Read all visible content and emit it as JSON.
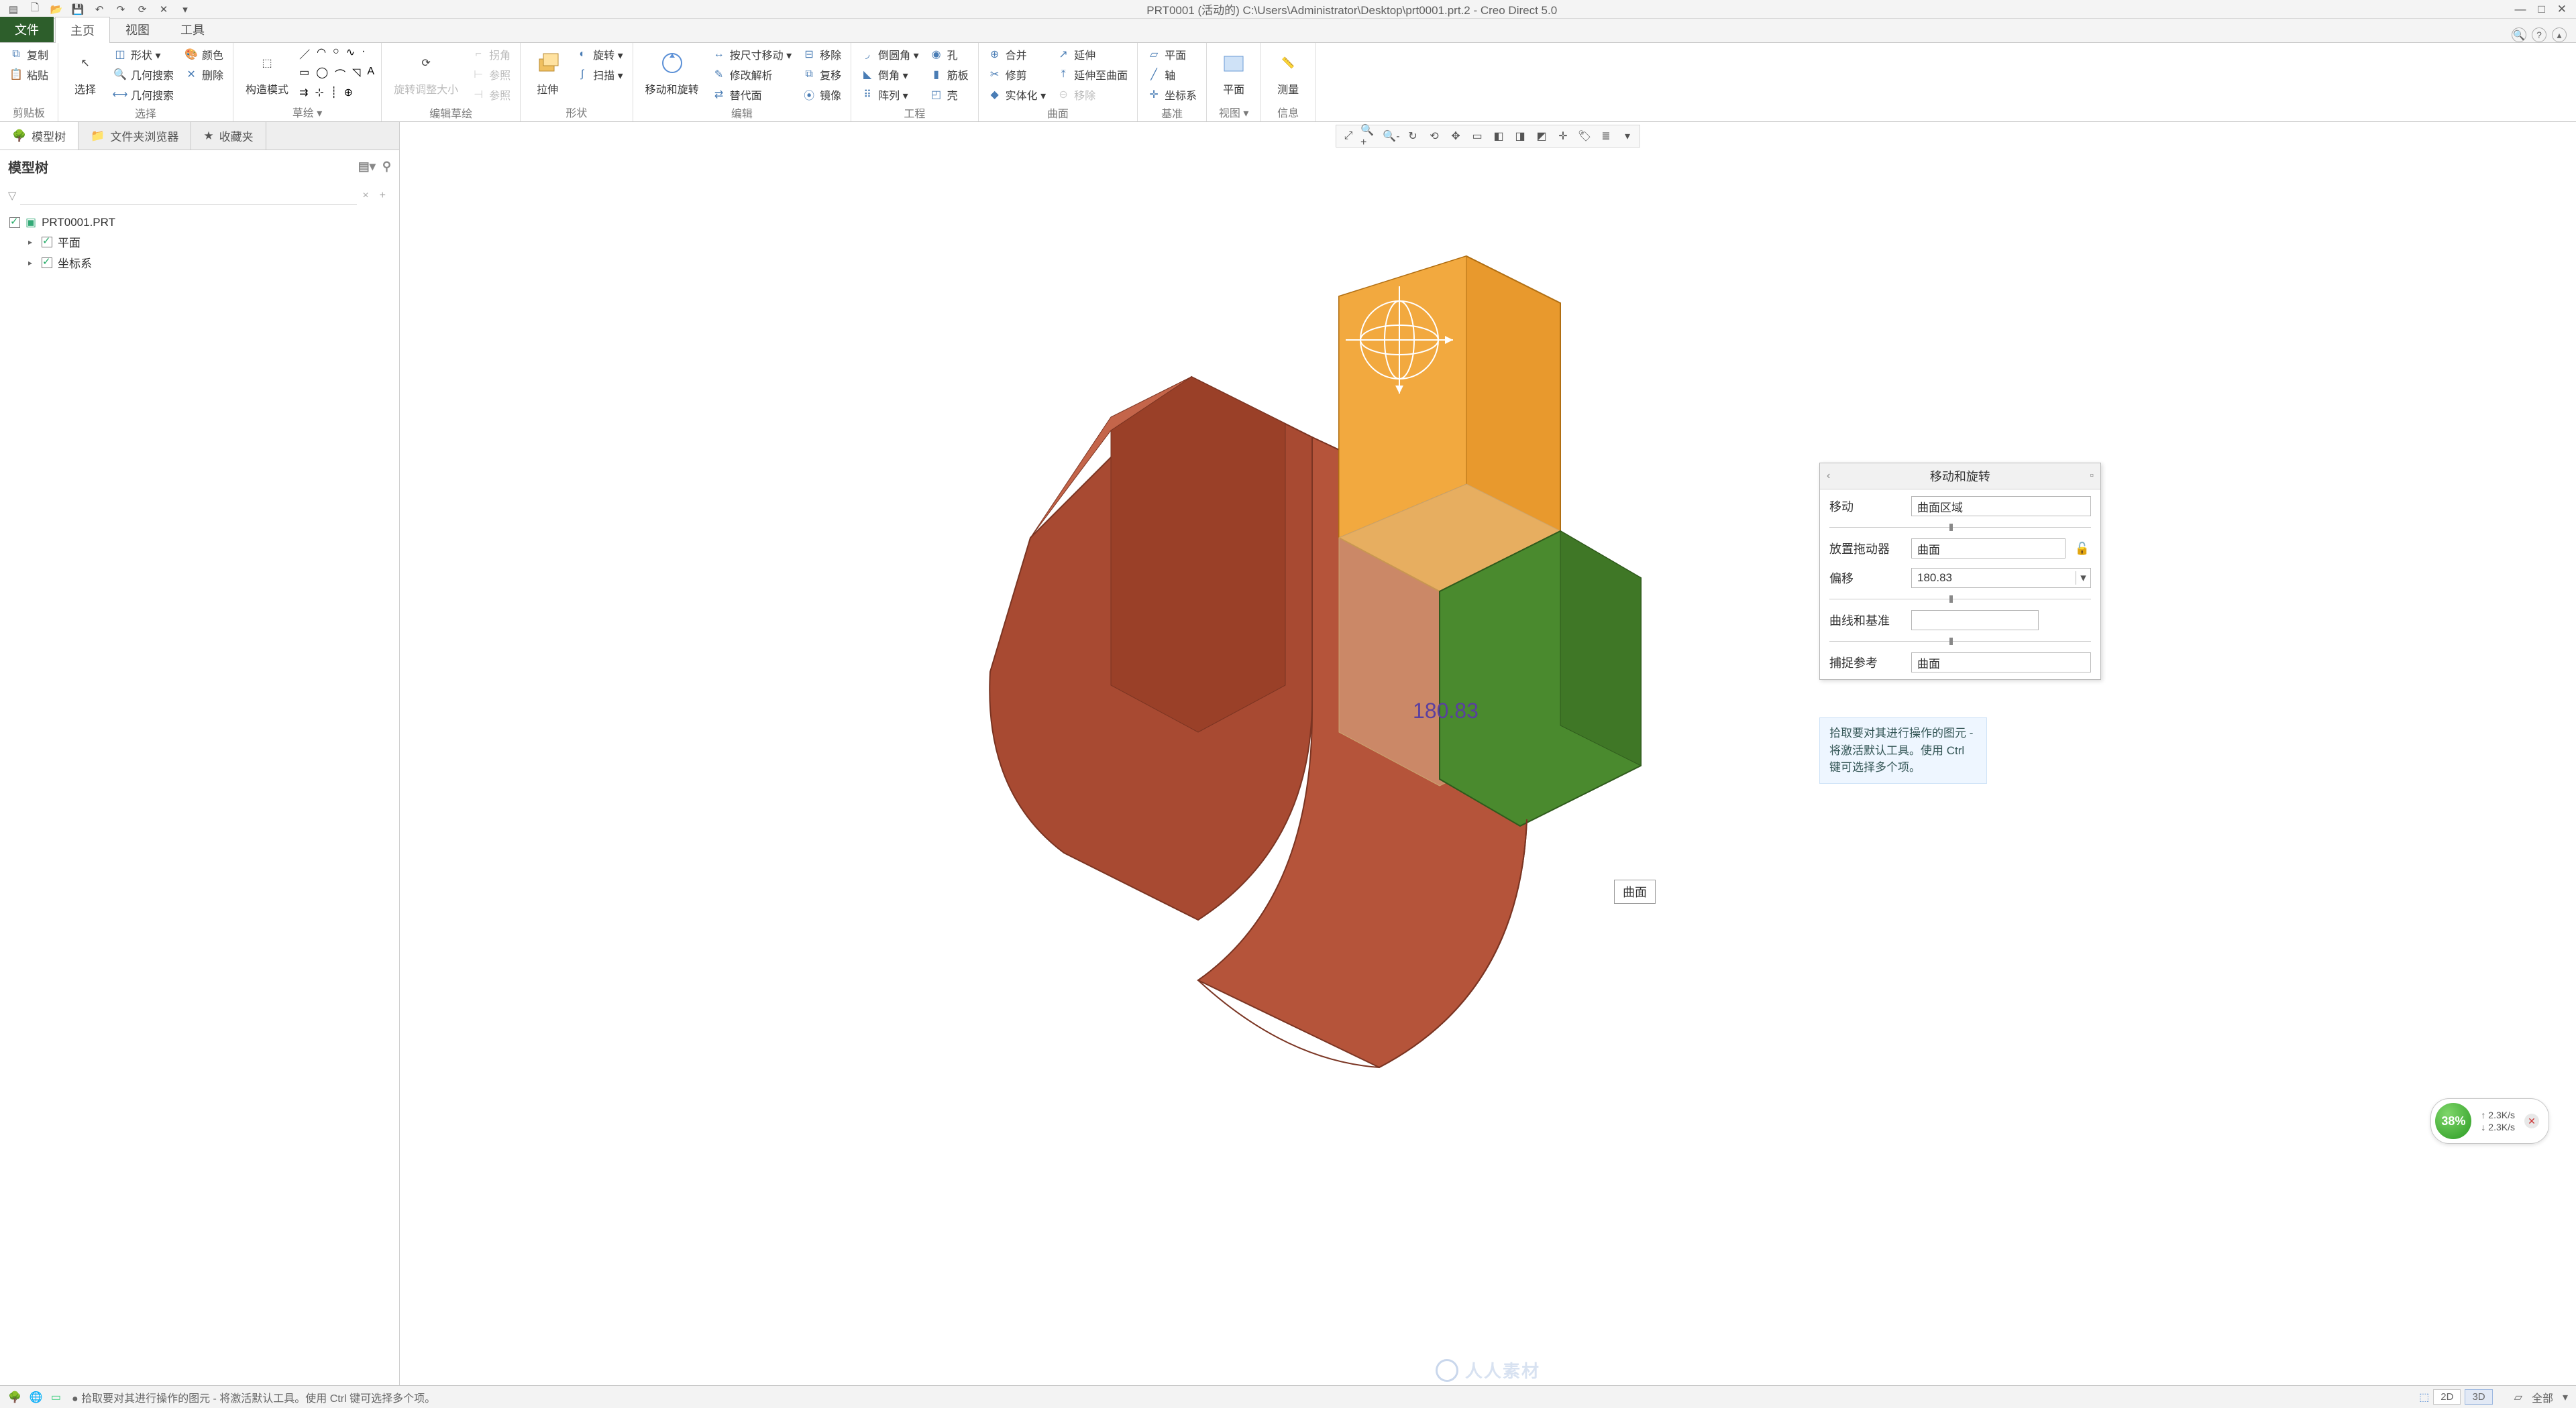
{
  "title": "PRT0001 (活动的) C:\\Users\\Administrator\\Desktop\\prt0001.prt.2 - Creo Direct 5.0",
  "tabs": {
    "file": "文件",
    "home": "主页",
    "view": "视图",
    "tools": "工具"
  },
  "ribbon": {
    "g1": {
      "label": "剪贴板",
      "copy": "复制",
      "paste": "粘贴"
    },
    "g2": {
      "label": "选择",
      "select": "选择",
      "shape": "形状 ▾",
      "geosearch": "几何搜索",
      "color": "颜色",
      "delete": "删除",
      "dimsearch": "几何搜索"
    },
    "g3": {
      "label": "草绘 ▾",
      "mode": "构造模式"
    },
    "g4": {
      "label": "编辑草绘",
      "rot": "旋转调整大小",
      "trim": "拐角",
      "ref1": "参照",
      "ref2": "参照"
    },
    "g5": {
      "label": "形状",
      "extrude": "拉伸",
      "revolve": "旋转 ▾",
      "sweep": "扫描 ▾"
    },
    "g6": {
      "label": "编辑",
      "moverot": "移动和旋转",
      "dimsmove": "按尺寸移动 ▾",
      "analyze": "修改解析",
      "replace": "替代面",
      "move": "移除",
      "copyop": "复移",
      "mirror": "镜像"
    },
    "g7": {
      "label": "工程",
      "chamfer": "倒圆角 ▾",
      "edgech": "倒角 ▾",
      "pattern": "阵列 ▾",
      "hole": "孔",
      "rib": "筋板",
      "shell": "壳"
    },
    "g8": {
      "label": "曲面",
      "merge": "合并",
      "trim2": "修剪",
      "solidify": "实体化 ▾",
      "extend": "延伸",
      "exttosurf": "延伸至曲面",
      "remove": "移除"
    },
    "g9": {
      "label": "基准",
      "plane": "平面",
      "axis": "轴",
      "csys": "坐标系"
    },
    "g10": {
      "label": "视图 ▾",
      "plane2": "平面"
    },
    "g11": {
      "label": "信息",
      "measure": "测量"
    }
  },
  "tree": {
    "tabs": [
      "模型树",
      "文件夹浏览器",
      "收藏夹"
    ],
    "title": "模型树",
    "root": "PRT0001.PRT",
    "items": [
      "平面",
      "坐标系"
    ]
  },
  "panel": {
    "title": "移动和旋转",
    "move_lbl": "移动",
    "move_val": "曲面区域",
    "drag_lbl": "放置拖动器",
    "drag_val": "曲面",
    "offset_lbl": "偏移",
    "offset_val": "180.83",
    "curve_lbl": "曲线和基准",
    "snap_lbl": "捕捉参考",
    "snap_val": "曲面"
  },
  "hint": "拾取要对其进行操作的图元 - 将激活默认工具。使用 Ctrl 键可选择多个项。",
  "viewport": {
    "dim": "180.83",
    "surface": "曲面"
  },
  "perf": {
    "pct": "38%",
    "l1": "↑  2.3K/s",
    "l2": "↓  2.3K/s"
  },
  "status": {
    "msg": "● 拾取要对其进行操作的图元 - 将激活默认工具。使用 Ctrl 键可选择多个项。",
    "b2d": "2D",
    "b3d": "3D",
    "all": "全部"
  },
  "watermark": "人人素材"
}
